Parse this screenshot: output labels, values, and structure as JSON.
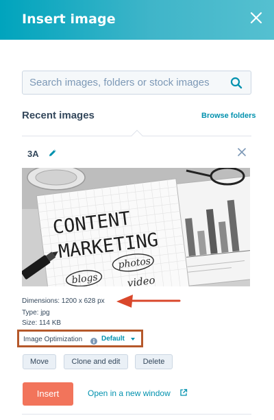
{
  "modal": {
    "title": "Insert image"
  },
  "search": {
    "placeholder": "Search images, folders or stock images"
  },
  "recent": {
    "title": "Recent images",
    "browse_label": "Browse folders"
  },
  "selected_image": {
    "name": "3A",
    "photo_text": {
      "line1": "CONTENT",
      "line2": "MARKETING",
      "bubble1": "blogs",
      "bubble2": "photos",
      "bubble3": "video"
    },
    "dimensions": "Dimensions: 1200 x 628 px",
    "type": "Type: jpg",
    "size": "Size: 114 KB",
    "optimization_label": "Image Optimization",
    "optimization_value": "Default"
  },
  "actions": {
    "move": "Move",
    "clone": "Clone and edit",
    "delete": "Delete",
    "insert": "Insert",
    "open_new_window": "Open in a new window"
  },
  "colors": {
    "header_teal": "#00a4bd",
    "link": "#0091ae",
    "insert_button": "#f2745b",
    "annotation": "#b5582a",
    "annotation_arrow": "#d9472b"
  }
}
